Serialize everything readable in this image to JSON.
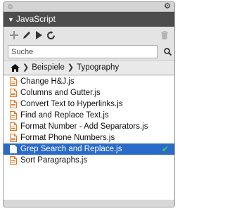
{
  "panel": {
    "title": "JavaScript"
  },
  "toolbar": {
    "buttons": [
      "add-icon",
      "edit-icon",
      "run-icon",
      "refresh-icon",
      "trash-icon"
    ]
  },
  "search": {
    "placeholder": "Suche"
  },
  "breadcrumb": {
    "items": [
      "Beispiele",
      "Typography"
    ]
  },
  "scripts": [
    "Change H&J.js",
    "Columns and Gutter.js",
    "Convert Text to Hyperlinks.js",
    "Find and Replace Text.js",
    "Format Number - Add Separators.js",
    "Format Phone Numbers.js",
    "Grep Search and Replace.js",
    "Sort Paragraphs.js"
  ],
  "selected_index": 6,
  "colors": {
    "header": "#4d4d4d",
    "selection": "#2a6ac8",
    "file_icon": "#e8761e",
    "check": "#3fd13f"
  }
}
